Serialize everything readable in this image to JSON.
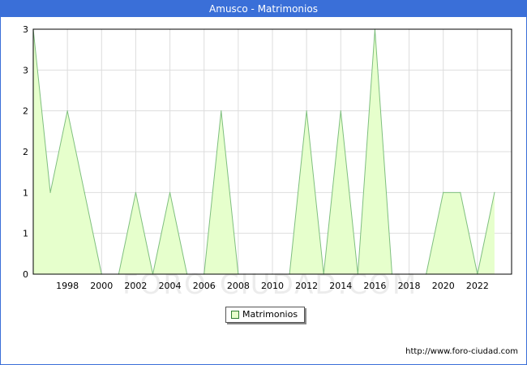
{
  "header": {
    "title": "Amusco - Matrimonios"
  },
  "watermark": "FORO-CIUDAD.COM",
  "source": "http://www.foro-ciudad.com",
  "colors": {
    "accent": "#3a6fd8",
    "fill": "#e6ffcc",
    "line": "#7fbf7f",
    "grid": "#dddddd"
  },
  "chart_data": {
    "type": "area",
    "title": "Amusco - Matrimonios",
    "xlabel": "",
    "ylabel": "",
    "xlim": [
      1996,
      2024
    ],
    "ylim": [
      0,
      3
    ],
    "x_ticks": [
      "1998",
      "2000",
      "2002",
      "2004",
      "2006",
      "2008",
      "2010",
      "2012",
      "2014",
      "2016",
      "2018",
      "2020",
      "2022"
    ],
    "y_tick_labels": [
      "0",
      "1",
      "1",
      "2",
      "2",
      "3",
      "3"
    ],
    "grid": true,
    "legend": "bottom-center",
    "series": [
      {
        "name": "Matrimonios",
        "x": [
          1996,
          1997,
          1998,
          1999,
          2000,
          2001,
          2002,
          2003,
          2004,
          2005,
          2006,
          2007,
          2008,
          2009,
          2010,
          2011,
          2012,
          2013,
          2014,
          2015,
          2016,
          2017,
          2018,
          2019,
          2020,
          2021,
          2022,
          2023
        ],
        "values": [
          3,
          1,
          2,
          1,
          0,
          0,
          1,
          0,
          1,
          0,
          0,
          2,
          0,
          0,
          0,
          0,
          2,
          0,
          2,
          0,
          3,
          0,
          0,
          0,
          1,
          1,
          0,
          1
        ]
      }
    ]
  }
}
